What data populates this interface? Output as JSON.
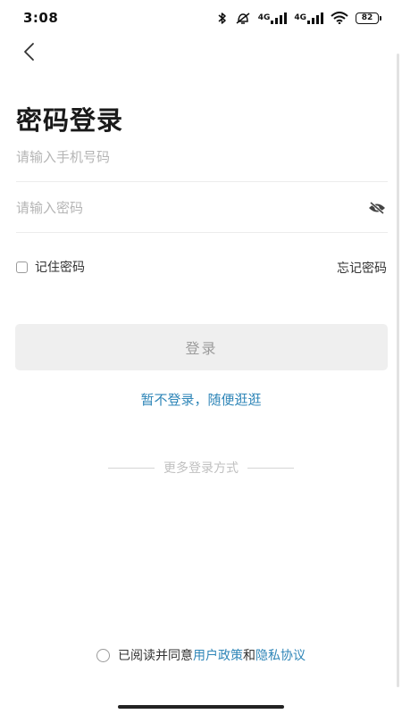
{
  "status_bar": {
    "time": "3:08",
    "network_1": "4G",
    "network_2": "4G",
    "battery": "82",
    "icons": [
      "bluetooth-icon",
      "alarm-off-icon",
      "signal-icon",
      "signal-icon",
      "wifi-icon",
      "battery-icon"
    ]
  },
  "header": {
    "back_icon": "back-arrow-icon",
    "title": "密码登录"
  },
  "form": {
    "phone_placeholder": "请输入手机号码",
    "password_placeholder": "请输入密码",
    "password_toggle_icon": "eye-off-icon",
    "remember_label": "记住密码",
    "forgot_label": "忘记密码",
    "login_label": "登录"
  },
  "skip_link": "暂不登录，随便逛逛",
  "more_methods": "更多登录方式",
  "agreement": {
    "prefix": "已阅读并同意",
    "user_policy": "用户政策",
    "conjunction": "和",
    "privacy": "隐私协议"
  },
  "colors": {
    "link": "#2f86b8",
    "button_bg": "#efefef",
    "button_text": "#9c9c9c",
    "placeholder": "#b5b5b5"
  }
}
